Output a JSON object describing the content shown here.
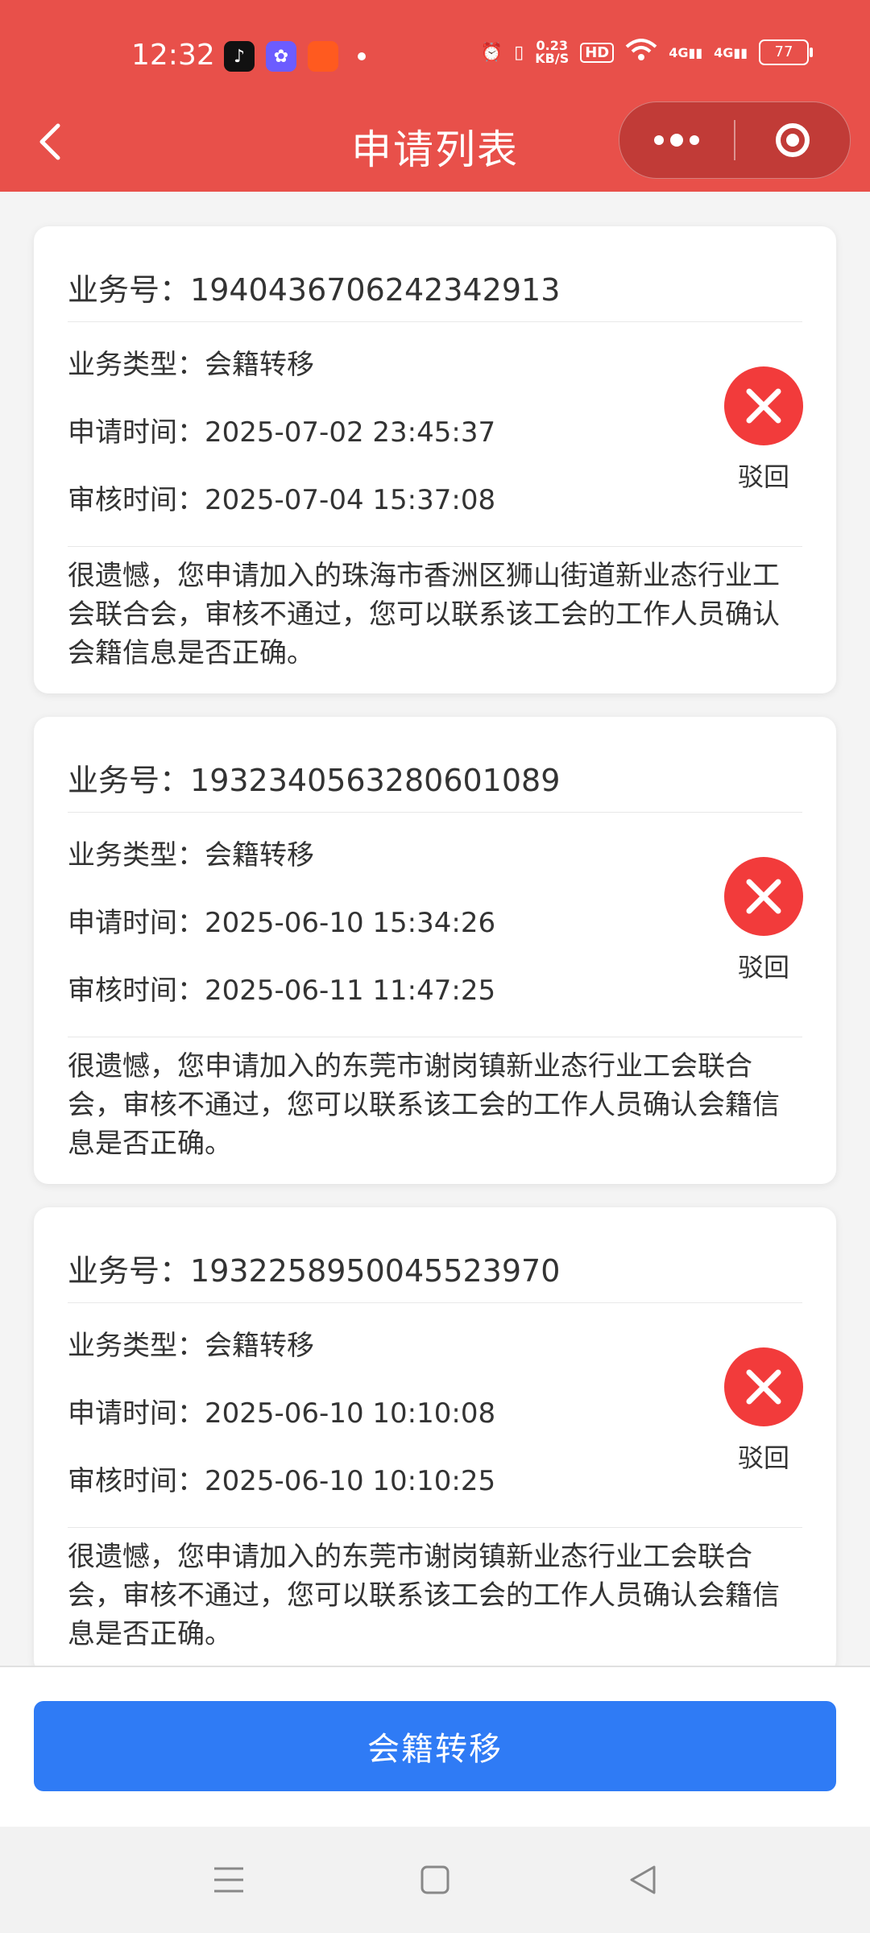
{
  "status_bar": {
    "time": "12:32",
    "net_speed_top": "0.23",
    "net_speed_unit": "KB/S",
    "hd": "HD",
    "signal1": "4G",
    "signal2": "4G",
    "battery": "77"
  },
  "navbar": {
    "title": "申请列表"
  },
  "labels": {
    "business_no": "业务号：",
    "business_type": "业务类型：",
    "apply_time": "申请时间：",
    "review_time": "审核时间："
  },
  "applications": [
    {
      "business_no": "1940436706242342913",
      "business_type": "会籍转移",
      "apply_time": "2025-07-02 23:45:37",
      "review_time": "2025-07-04 15:37:08",
      "status": "驳回",
      "message": "很遗憾，您申请加入的珠海市香洲区狮山街道新业态行业工会联合会，审核不通过，您可以联系该工会的工作人员确认会籍信息是否正确。"
    },
    {
      "business_no": "1932340563280601089",
      "business_type": "会籍转移",
      "apply_time": "2025-06-10 15:34:26",
      "review_time": "2025-06-11 11:47:25",
      "status": "驳回",
      "message": "很遗憾，您申请加入的东莞市谢岗镇新业态行业工会联合会，审核不通过，您可以联系该工会的工作人员确认会籍信息是否正确。"
    },
    {
      "business_no": "1932258950045523970",
      "business_type": "会籍转移",
      "apply_time": "2025-06-10 10:10:08",
      "review_time": "2025-06-10 10:10:25",
      "status": "驳回",
      "message": "很遗憾，您申请加入的东莞市谢岗镇新业态行业工会联合会，审核不通过，您可以联系该工会的工作人员确认会籍信息是否正确。"
    }
  ],
  "bottom": {
    "button_label": "会籍转移"
  },
  "colors": {
    "header_bg": "#e8504a",
    "reject_red": "#f23b3b",
    "primary_blue": "#2f7bf5"
  }
}
